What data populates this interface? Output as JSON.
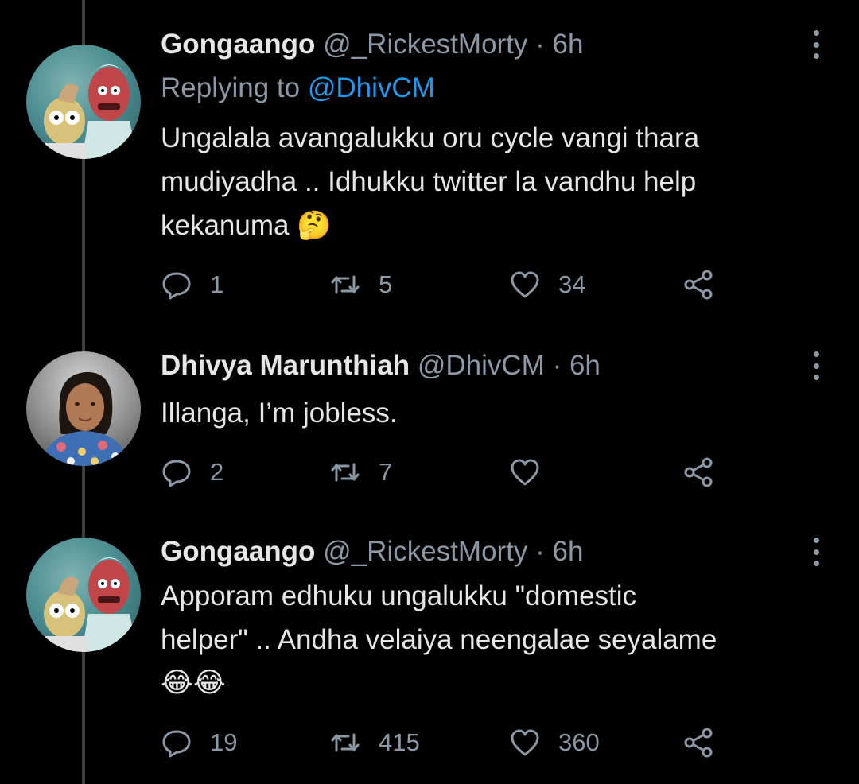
{
  "tweets": [
    {
      "name": "Gongaango",
      "handle": "@_RickestMorty",
      "separator": "·",
      "time": "6h",
      "reply_prefix": "Replying to ",
      "reply_handle": "@DhivCM",
      "text_lines": [
        "Ungalala avangalukku oru cycle vangi thara",
        "mudiyadha .. Idhukku twitter la vandhu help",
        "kekanuma"
      ],
      "emoji": "🤔",
      "replies": "1",
      "retweets": "5",
      "likes": "34",
      "avatar_icon": "rick-and-morty-avatar"
    },
    {
      "name": "Dhivya Marunthiah",
      "handle": "@DhivCM",
      "separator": "·",
      "time": "6h",
      "text_lines": [
        "Illanga, I’m jobless."
      ],
      "replies": "2",
      "retweets": "7",
      "likes": "",
      "avatar_icon": "user-photo-avatar"
    },
    {
      "name": "Gongaango",
      "handle": "@_RickestMorty",
      "separator": "·",
      "time": "6h",
      "text_lines": [
        "Apporam edhuku ungalukku \"domestic",
        "helper\" .. Andha velaiya neengalae seyalame"
      ],
      "emoji": "😂😂",
      "replies": "19",
      "retweets": "415",
      "likes": "360",
      "avatar_icon": "rick-and-morty-avatar"
    }
  ],
  "colors": {
    "background": "#000000",
    "text": "#e6e6e6",
    "secondary": "#8b98a5",
    "link": "#1d9bf0",
    "thread_line": "#3d4144"
  }
}
